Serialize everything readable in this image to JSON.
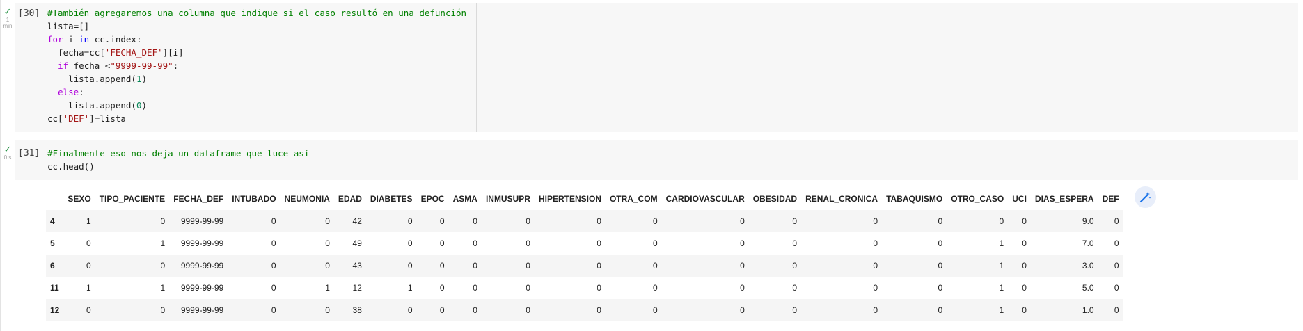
{
  "cells": [
    {
      "id": "cell-30",
      "exec_count": "[30]",
      "status_icon": "check-icon",
      "duration": [
        "1",
        "min"
      ],
      "code_lines": [
        [
          [
            "#También agregaremos una columna que indique si el caso resultó en una defunción",
            "cm"
          ]
        ],
        [
          [
            "lista=[]",
            ""
          ]
        ],
        [
          [
            "for",
            "kw"
          ],
          [
            " i ",
            ""
          ],
          [
            "in",
            "bi"
          ],
          [
            " cc.index:",
            ""
          ]
        ],
        [
          [
            "  fecha=cc[",
            ""
          ],
          [
            "'FECHA_DEF'",
            "st"
          ],
          [
            "][i]",
            ""
          ]
        ],
        [
          [
            "  ",
            ""
          ],
          [
            "if",
            "kw"
          ],
          [
            " fecha <",
            ""
          ],
          [
            "\"9999-99-99\"",
            "st"
          ],
          [
            ":",
            ""
          ]
        ],
        [
          [
            "    lista.append(",
            ""
          ],
          [
            "1",
            "nu"
          ],
          [
            ")",
            ""
          ]
        ],
        [
          [
            "  ",
            ""
          ],
          [
            "else",
            "kw"
          ],
          [
            ":",
            ""
          ]
        ],
        [
          [
            "    lista.append(",
            ""
          ],
          [
            "0",
            "nu"
          ],
          [
            ")",
            ""
          ]
        ],
        [
          [
            "cc[",
            ""
          ],
          [
            "'DEF'",
            "st"
          ],
          [
            "]=lista",
            ""
          ]
        ]
      ]
    },
    {
      "id": "cell-31",
      "exec_count": "[31]",
      "status_icon": "check-icon",
      "duration": [
        "0 s"
      ],
      "code_lines": [
        [
          [
            "#Finalmente eso nos deja un dataframe que luce así",
            "cm"
          ]
        ],
        [
          [
            "cc.head()",
            ""
          ]
        ]
      ]
    }
  ],
  "colors": {
    "comment": "#008000",
    "keyword": "#af00db",
    "builtin": "#0000ff",
    "string": "#a31515",
    "number": "#098658"
  },
  "dataframe": {
    "columns": [
      "",
      "SEXO",
      "TIPO_PACIENTE",
      "FECHA_DEF",
      "INTUBADO",
      "NEUMONIA",
      "EDAD",
      "DIABETES",
      "EPOC",
      "ASMA",
      "INMUSUPR",
      "HIPERTENSION",
      "OTRA_COM",
      "CARDIOVASCULAR",
      "OBESIDAD",
      "RENAL_CRONICA",
      "TABAQUISMO",
      "OTRO_CASO",
      "UCI",
      "DIAS_ESPERA",
      "DEF"
    ],
    "rows": [
      [
        "4",
        "1",
        "0",
        "9999-99-99",
        "0",
        "0",
        "42",
        "0",
        "0",
        "0",
        "0",
        "0",
        "0",
        "0",
        "0",
        "0",
        "0",
        "0",
        "0",
        "9.0",
        "0"
      ],
      [
        "5",
        "0",
        "1",
        "9999-99-99",
        "0",
        "0",
        "49",
        "0",
        "0",
        "0",
        "0",
        "0",
        "0",
        "0",
        "0",
        "0",
        "0",
        "1",
        "0",
        "7.0",
        "0"
      ],
      [
        "6",
        "0",
        "0",
        "9999-99-99",
        "0",
        "0",
        "43",
        "0",
        "0",
        "0",
        "0",
        "0",
        "0",
        "0",
        "0",
        "0",
        "0",
        "1",
        "0",
        "3.0",
        "0"
      ],
      [
        "11",
        "1",
        "1",
        "9999-99-99",
        "0",
        "1",
        "12",
        "1",
        "0",
        "0",
        "0",
        "0",
        "0",
        "0",
        "0",
        "0",
        "0",
        "1",
        "0",
        "5.0",
        "0"
      ],
      [
        "12",
        "0",
        "0",
        "9999-99-99",
        "0",
        "0",
        "38",
        "0",
        "0",
        "0",
        "0",
        "0",
        "0",
        "0",
        "0",
        "0",
        "0",
        "1",
        "0",
        "1.0",
        "0"
      ]
    ]
  },
  "toolbar": {
    "icon": "magic-wand-icon"
  }
}
